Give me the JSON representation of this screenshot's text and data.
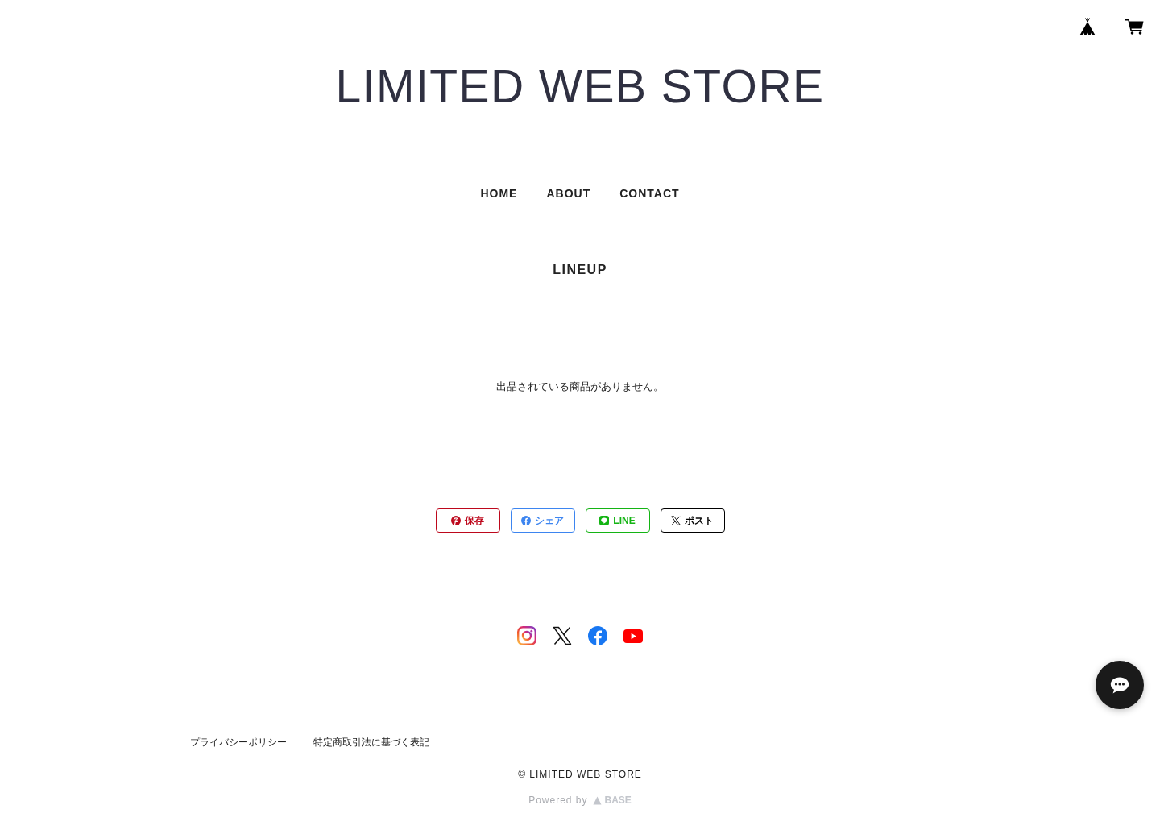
{
  "store_title": "LIMITED WEB STORE",
  "nav": [
    {
      "label": "HOME"
    },
    {
      "label": "ABOUT"
    },
    {
      "label": "CONTACT"
    }
  ],
  "section_heading": "LINEUP",
  "empty_message": "出品されている商品がありません。",
  "share_buttons": [
    {
      "kind": "pinterest",
      "label": "保存",
      "color": "#bd081c"
    },
    {
      "kind": "facebook",
      "label": "シェア",
      "color": "#3d85f0"
    },
    {
      "kind": "line",
      "label": "LINE",
      "color": "#14b414"
    },
    {
      "kind": "x",
      "label": "ポスト",
      "color": "#000000"
    }
  ],
  "social_links": [
    {
      "kind": "instagram"
    },
    {
      "kind": "x"
    },
    {
      "kind": "facebook"
    },
    {
      "kind": "youtube"
    }
  ],
  "footer": {
    "links": [
      "プライバシーポリシー",
      "特定商取引法に基づく表記"
    ],
    "copyright": "© LIMITED WEB STORE",
    "powered_by": "Powered by",
    "logo_text": "BASE"
  }
}
